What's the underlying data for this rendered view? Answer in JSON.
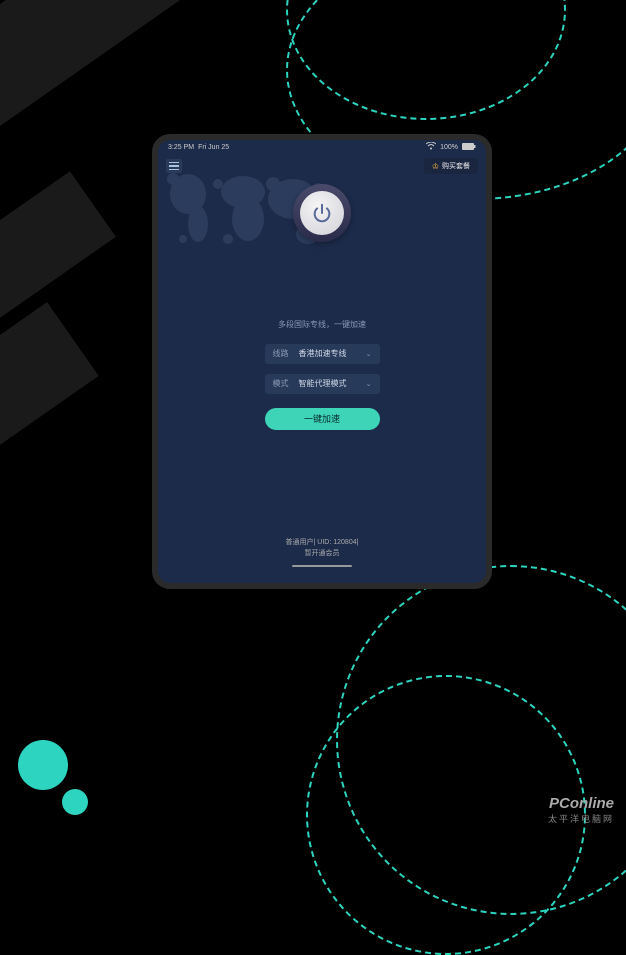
{
  "status": {
    "time": "3:25 PM",
    "date": "Fri Jun 25",
    "battery": "100%"
  },
  "topbar": {
    "purchase_label": "购买套餐"
  },
  "main": {
    "tagline": "多段国际专线，一键加速",
    "route_label": "线路",
    "route_value": "香港加速专线",
    "mode_label": "模式",
    "mode_value": "智能代理模式",
    "accelerate_label": "一键加速"
  },
  "footer": {
    "user_info": "普通用户| UID: 120804|",
    "member_info": "暂开通会员"
  },
  "watermark": {
    "main": "PConline",
    "sub": "太平洋电脑网"
  },
  "colors": {
    "accent_teal": "#3dd4b8",
    "bg_navy": "#1c2b4a"
  }
}
